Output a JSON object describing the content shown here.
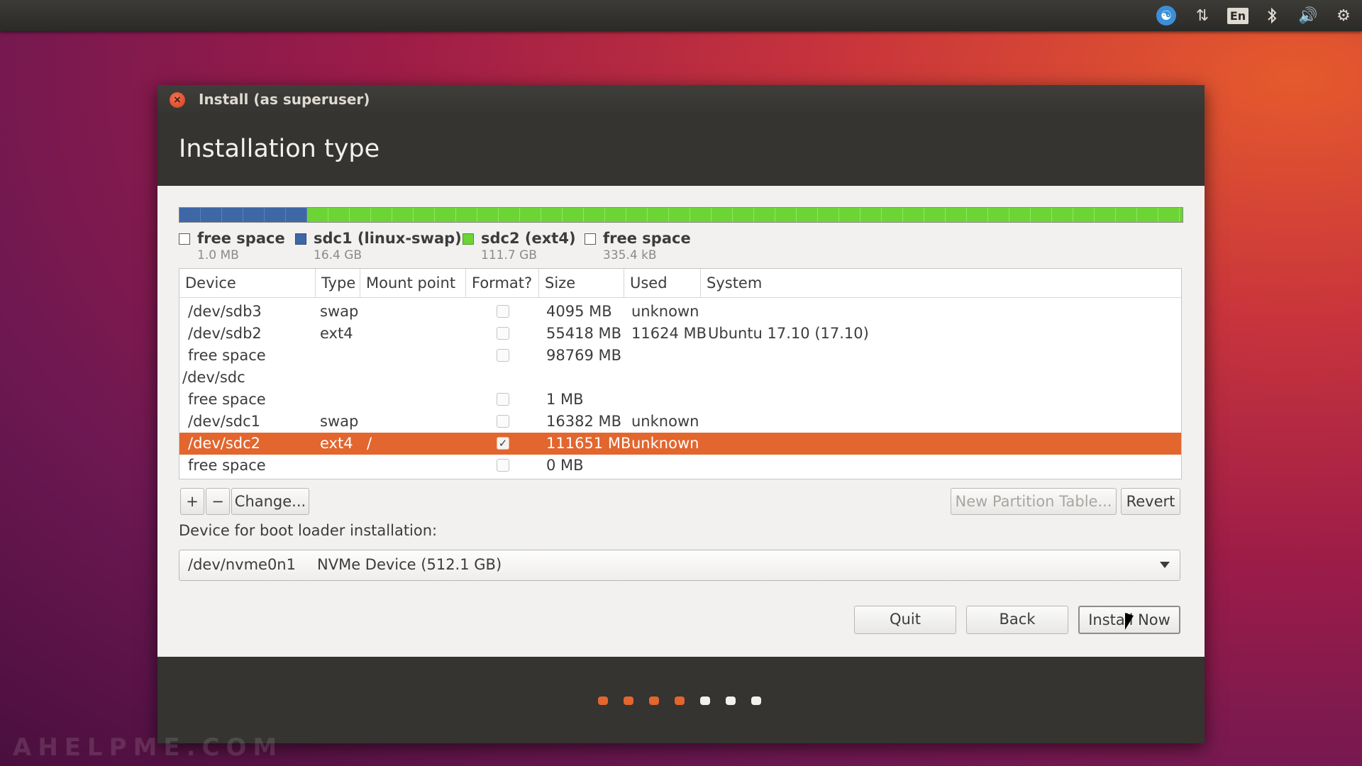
{
  "top_panel": {
    "indicators": {
      "accessibility": "accessibility-icon",
      "network": "network-updown-icon",
      "language": "En",
      "bluetooth": "bluetooth-icon",
      "volume": "volume-icon",
      "settings": "gear-icon"
    }
  },
  "window": {
    "title": "Install (as superuser)",
    "page_title": "Installation type"
  },
  "partition_bar": {
    "segments": [
      {
        "name": "free space",
        "size": "1.0 MB",
        "color": "#ffffff"
      },
      {
        "name": "sdc1 (linux-swap)",
        "size": "16.4 GB",
        "color": "#3e67a6"
      },
      {
        "name": "sdc2 (ext4)",
        "size": "111.7 GB",
        "color": "#6dd436"
      },
      {
        "name": "free space",
        "size": "335.4 kB",
        "color": "#ffffff"
      }
    ]
  },
  "table": {
    "headers": [
      "Device",
      "Type",
      "Mount point",
      "Format?",
      "Size",
      "Used",
      "System"
    ],
    "rows": [
      {
        "device": "/dev/sdb3",
        "type": "swap",
        "mount": "",
        "format": false,
        "size": "4095 MB",
        "used": "unknown",
        "system": ""
      },
      {
        "device": "/dev/sdb2",
        "type": "ext4",
        "mount": "",
        "format": false,
        "size": "55418 MB",
        "used": "11624 MB",
        "system": "Ubuntu 17.10 (17.10)"
      },
      {
        "device": "free space",
        "type": "",
        "mount": "",
        "format": false,
        "size": "98769 MB",
        "used": "",
        "system": ""
      },
      {
        "device": "/dev/sdc",
        "type": "",
        "mount": "",
        "format": null,
        "size": "",
        "used": "",
        "system": ""
      },
      {
        "device": "free space",
        "type": "",
        "mount": "",
        "format": false,
        "size": "1 MB",
        "used": "",
        "system": ""
      },
      {
        "device": "/dev/sdc1",
        "type": "swap",
        "mount": "",
        "format": false,
        "size": "16382 MB",
        "used": "unknown",
        "system": ""
      },
      {
        "device": "/dev/sdc2",
        "type": "ext4",
        "mount": "/",
        "format": true,
        "size": "111651 MB",
        "used": "unknown",
        "system": "",
        "selected": true
      },
      {
        "device": "free space",
        "type": "",
        "mount": "",
        "format": false,
        "size": "0 MB",
        "used": "",
        "system": ""
      }
    ]
  },
  "table_buttons": {
    "add": "+",
    "remove": "−",
    "change": "Change...",
    "new_partition_table": "New Partition Table...",
    "revert": "Revert"
  },
  "bootloader": {
    "label": "Device for boot loader installation:",
    "device": "/dev/nvme0n1",
    "description": "NVMe Device (512.1 GB)"
  },
  "actions": {
    "quit": "Quit",
    "back": "Back",
    "install_now": "Install Now"
  },
  "progress": {
    "total_steps": 7,
    "completed_steps": 4,
    "active_color": "#e2662e",
    "inactive_color": "#f2f1f0"
  },
  "watermark": "AHELPME.COM",
  "colors": {
    "selection": "#e2662e",
    "header_bg": "#353430"
  }
}
